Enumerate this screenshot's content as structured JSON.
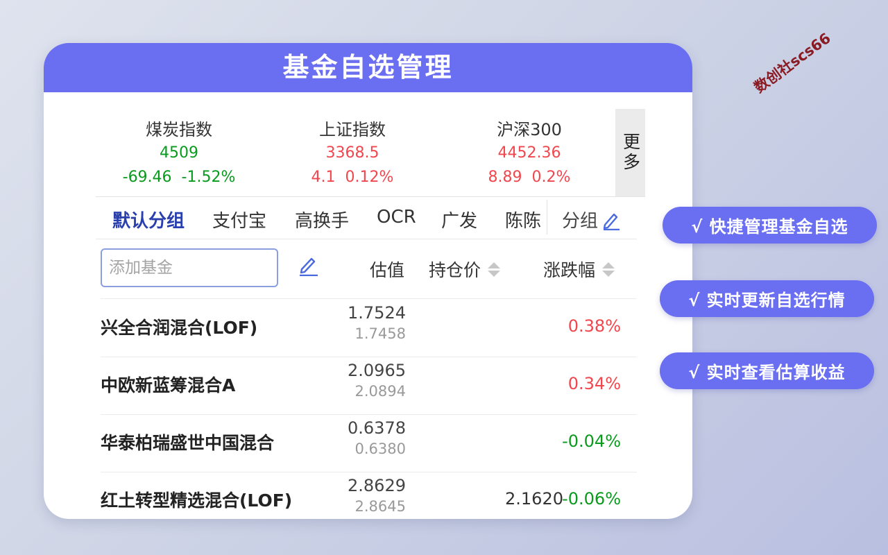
{
  "title": "基金自选管理",
  "indexes": [
    {
      "name": "煤炭指数",
      "value": "4509",
      "change": "-69.46",
      "change_pct": "-1.52%",
      "trend": "down"
    },
    {
      "name": "上证指数",
      "value": "3368.5",
      "change": "4.1",
      "change_pct": "0.12%",
      "trend": "up"
    },
    {
      "name": "沪深300",
      "value": "4452.36",
      "change": "8.89",
      "change_pct": "0.2%",
      "trend": "up"
    }
  ],
  "more_label": "更多",
  "tabs": [
    "默认分组",
    "支付宝",
    "高换手",
    "OCR",
    "广发",
    "陈陈"
  ],
  "group_label": "分组",
  "search": {
    "placeholder": "添加基金",
    "value": ""
  },
  "columns": {
    "estimate": "估值",
    "cost": "持仓价",
    "change": "涨跌幅"
  },
  "funds": [
    {
      "name": "兴全合润混合(LOF)",
      "estimate": "1.7524",
      "nav": "1.7458",
      "cost": "",
      "change": "0.38%",
      "trend": "up"
    },
    {
      "name": "中欧新蓝筹混合A",
      "estimate": "2.0965",
      "nav": "2.0894",
      "cost": "",
      "change": "0.34%",
      "trend": "up"
    },
    {
      "name": "华泰柏瑞盛世中国混合",
      "estimate": "0.6378",
      "nav": "0.6380",
      "cost": "",
      "change": "-0.04%",
      "trend": "down"
    },
    {
      "name": "红土转型精选混合(LOF)",
      "estimate": "2.8629",
      "nav": "2.8645",
      "cost": "2.1620",
      "change": "-0.06%",
      "trend": "down"
    }
  ],
  "features": [
    "√  快捷管理基金自选",
    "√  实时更新自选行情",
    "√  实时查看估算收益"
  ],
  "watermark": "数创社scs66",
  "colors": {
    "accent": "#6a6ef0",
    "up": "#f0474f",
    "down": "#0a9a1e",
    "active_tab": "#2a3fae"
  }
}
